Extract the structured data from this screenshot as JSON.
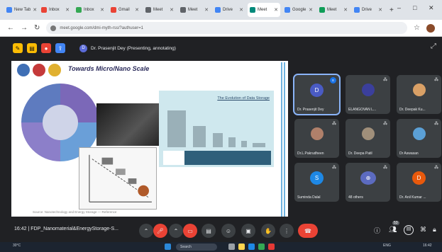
{
  "browser": {
    "tabs": [
      {
        "label": "New Tab",
        "color": "#4285f4"
      },
      {
        "label": "Inbox",
        "color": "#ea4335"
      },
      {
        "label": "Inbox",
        "color": "#34a853"
      },
      {
        "label": "Gmail",
        "color": "#ea4335"
      },
      {
        "label": "Meet",
        "color": "#5f6368"
      },
      {
        "label": "Meet",
        "color": "#5f6368"
      },
      {
        "label": "Drive",
        "color": "#4285f4"
      },
      {
        "label": "Meet",
        "color": "#00897b"
      },
      {
        "label": "Google",
        "color": "#4285f4"
      },
      {
        "label": "Meet",
        "color": "#0f9d58"
      },
      {
        "label": "Drive",
        "color": "#4285f4"
      }
    ],
    "active_tab_index": 7,
    "url": "meet.google.com/dmi-myth-rss/?authuser=1",
    "new_tab": "+",
    "window_controls": [
      "–",
      "□",
      "✕"
    ]
  },
  "meet_toolbar": {
    "presenter_initial": "D",
    "presenting_text": "Dr. Prasenjit Dey (Presenting, annotating)"
  },
  "slide": {
    "title": "Towards Micro/Nano Scale",
    "panel_title": "The Evolution of Data Storage",
    "footer": "Source: Nanotechnology and Energy Storage — Reference"
  },
  "participants": [
    {
      "name": "Dr. Prasenjit Dey",
      "kind": "letter",
      "letter": "D",
      "color": "#4a5bc4",
      "speaking": true
    },
    {
      "name": "ELANGOVAN L...",
      "kind": "photo",
      "color": "#3b3f9c"
    },
    {
      "name": "Dr. Deepak Ku...",
      "kind": "photo",
      "color": "#d9a066"
    },
    {
      "name": "Dr.L.Pakrudheen",
      "kind": "photo",
      "color": "#b0806a"
    },
    {
      "name": "Dr. Deepa Patil",
      "kind": "photo",
      "color": "#a08f7a"
    },
    {
      "name": "Dr Aswasan",
      "kind": "photo",
      "color": "#5ba0d6"
    },
    {
      "name": "Suminda Dalal",
      "kind": "letter",
      "letter": "S",
      "color": "#1e88e5"
    },
    {
      "name": "48 others",
      "kind": "others",
      "color": "#5c6bc0"
    },
    {
      "name": "Dr. Anil Kumar ...",
      "kind": "letter",
      "letter": "D",
      "color": "#e8590c"
    }
  ],
  "controls": {
    "time": "16:42",
    "separator": "|",
    "meeting_name": "FDP_Nanomaterial&EnergyStorage-S...",
    "people_count": "53"
  },
  "taskbar": {
    "weather": "30°C",
    "search_placeholder": "Search",
    "lang": "ENG",
    "clock": "16:42"
  }
}
